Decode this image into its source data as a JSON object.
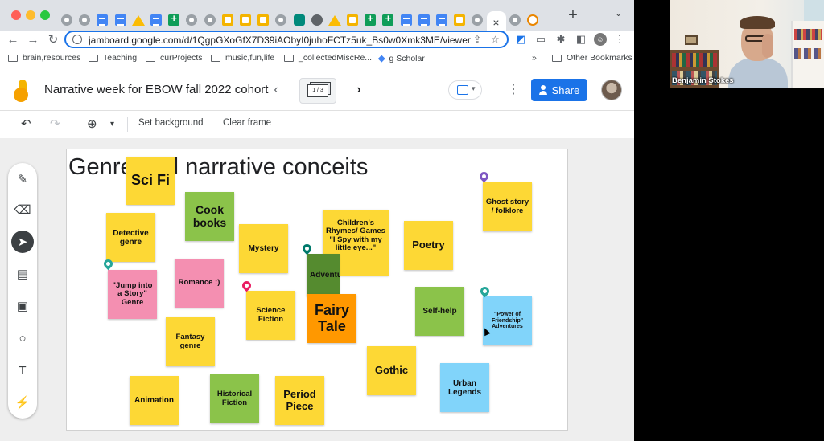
{
  "browser": {
    "tab_close": "×",
    "new_tab": "+",
    "tab_menu": "⌄",
    "url": "jamboard.google.com/d/1QgpGXoGfX7D39iAObyI0juhoFCTz5uk_Bs0w0Xmk3ME/viewer?..."
  },
  "bookmarks": [
    {
      "label": "brain,resources"
    },
    {
      "label": "Teaching"
    },
    {
      "label": "curProjects"
    },
    {
      "label": "music,fun,life"
    },
    {
      "label": "_collectedMiscRe..."
    },
    {
      "label": "g Scholar"
    },
    {
      "label": "»"
    },
    {
      "label": "Other Bookmarks"
    }
  ],
  "jamboard": {
    "doc_title": "Narrative week for EBOW fall 2022 cohort",
    "frame_indicator": "1 / 3",
    "share_label": "Share",
    "toolbar": {
      "set_background": "Set background",
      "clear_frame": "Clear frame"
    },
    "frame_title": "Genre and narrative conceits",
    "notes": [
      {
        "text": "Sci Fi",
        "color": "#fdd835"
      },
      {
        "text": "Cook books",
        "color": "#8bc34a"
      },
      {
        "text": "Detective genre",
        "color": "#fdd835"
      },
      {
        "text": "Mystery",
        "color": "#fdd835"
      },
      {
        "text": "Children's Rhymes/ Games \"I Spy with my little eye...\"",
        "color": "#fdd835"
      },
      {
        "text": "Poetry",
        "color": "#fdd835"
      },
      {
        "text": "Ghost story / folklore",
        "color": "#fdd835"
      },
      {
        "text": "Romance :)",
        "color": "#f48fb1"
      },
      {
        "text": "\"Jump into a Story\" Genre",
        "color": "#f48fb1"
      },
      {
        "text": "Adventure",
        "color": "#558b2f"
      },
      {
        "text": "Science Fiction",
        "color": "#fdd835"
      },
      {
        "text": "Fairy Tale",
        "color": "#ff9800"
      },
      {
        "text": "Self-help",
        "color": "#8bc34a"
      },
      {
        "text": "\"Power of Friendship\" Adventures",
        "color": "#81d4fa"
      },
      {
        "text": "Fantasy genre",
        "color": "#fdd835"
      },
      {
        "text": "Gothic",
        "color": "#fdd835"
      },
      {
        "text": "Urban Legends",
        "color": "#81d4fa"
      },
      {
        "text": "Animation",
        "color": "#fdd835"
      },
      {
        "text": "Historical Fiction",
        "color": "#8bc34a"
      },
      {
        "text": "Period Piece",
        "color": "#fdd835"
      }
    ]
  },
  "video": {
    "participant_name": "Benjamin Stokes"
  },
  "icons": {
    "back": "←",
    "forward": "→",
    "reload": "↻",
    "undo": "↶",
    "redo": "↷",
    "zoom": "⊕",
    "caret": "▾",
    "prev": "‹",
    "next": "›",
    "kebab": "⋮",
    "pen": "✎",
    "eraser": "⌫",
    "select": "➤",
    "note": "▤",
    "image": "▣",
    "circle": "○",
    "textbox": "T",
    "laser": "⚡"
  }
}
